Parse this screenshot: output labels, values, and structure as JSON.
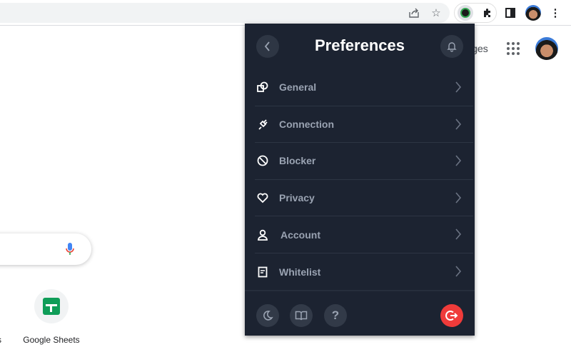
{
  "browser": {
    "extension_icons": [
      "share-icon",
      "star-icon",
      "vpn-extension-icon",
      "puzzle-icon",
      "side-panel-icon",
      "profile-avatar",
      "more-vert-icon"
    ]
  },
  "google": {
    "images_link": "Images",
    "images_visible": "ges",
    "shortcut_label": "Google Sheets",
    "cut_label": "s"
  },
  "popup": {
    "title": "Preferences",
    "items": [
      {
        "label": "General",
        "icon": "shapes-icon"
      },
      {
        "label": "Connection",
        "icon": "plug-icon"
      },
      {
        "label": "Blocker",
        "icon": "block-icon"
      },
      {
        "label": "Privacy",
        "icon": "heart-shield-icon"
      },
      {
        "label": "Account",
        "icon": "user-icon"
      },
      {
        "label": "Whitelist",
        "icon": "document-icon"
      }
    ],
    "footer": {
      "help_glyph": "?"
    },
    "colors": {
      "background": "#1c2331",
      "logout": "#ef3b3a"
    }
  }
}
